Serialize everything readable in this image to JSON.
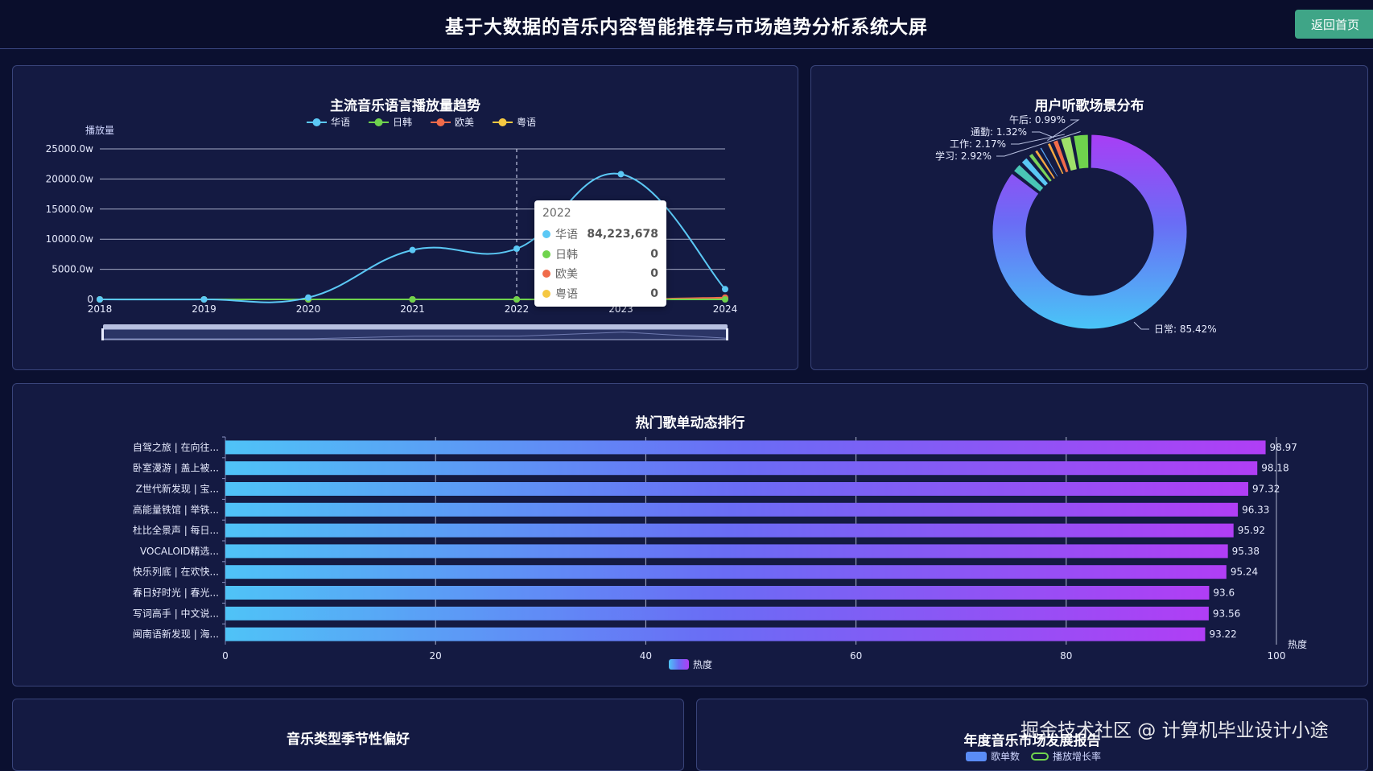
{
  "header": {
    "title": "基于大数据的音乐内容智能推荐与市场趋势分析系统大屏",
    "home_button": "返回首页"
  },
  "watermark": "掘金技术社区 @ 计算机毕业设计小途",
  "colors": {
    "cn": "#5bc8f5",
    "jk": "#6fd34d",
    "eu": "#f06b4a",
    "yue": "#f5c842",
    "bar_start": "#4fc3f7",
    "bar_end": "#b03ef5"
  },
  "tooltip": {
    "title": "2022",
    "rows": [
      {
        "name": "华语",
        "value": "84,223,678",
        "color": "#5bc8f5"
      },
      {
        "name": "日韩",
        "value": "0",
        "color": "#6fd34d"
      },
      {
        "name": "欧美",
        "value": "0",
        "color": "#f06b4a"
      },
      {
        "name": "粤语",
        "value": "0",
        "color": "#f5c842"
      }
    ]
  },
  "chart_data": [
    {
      "type": "line",
      "title": "主流音乐语言播放量趋势",
      "ylabel": "播放量",
      "x": [
        "2018",
        "2019",
        "2020",
        "2021",
        "2022",
        "2023",
        "2024"
      ],
      "ylim": [
        0,
        25000
      ],
      "yticks": [
        "0",
        "5000.0w",
        "10000.0w",
        "15000.0w",
        "20000.0w",
        "25000.0w"
      ],
      "legend": [
        "华语",
        "日韩",
        "欧美",
        "粤语"
      ],
      "series": [
        {
          "name": "华语",
          "values": [
            0,
            0,
            300,
            8200,
            8422,
            20800,
            1700
          ]
        },
        {
          "name": "日韩",
          "values": [
            0,
            0,
            0,
            0,
            0,
            0,
            0
          ]
        },
        {
          "name": "欧美",
          "values": [
            0,
            0,
            0,
            0,
            0,
            0,
            300
          ]
        },
        {
          "name": "粤语",
          "values": [
            0,
            0,
            0,
            0,
            0,
            0,
            100
          ]
        }
      ]
    },
    {
      "type": "pie",
      "title": "用户听歌场景分布",
      "labeled_slices": [
        {
          "label": "日常: 85.42%",
          "value": 85.42
        },
        {
          "label": "学习: 2.92%",
          "value": 2.92
        },
        {
          "label": "工作: 2.17%",
          "value": 2.17
        },
        {
          "label": "通勤: 1.32%",
          "value": 1.32
        },
        {
          "label": "午后: 0.99%",
          "value": 0.99
        }
      ],
      "other_slices": [
        1.9,
        1.6,
        1.2,
        1.0,
        0.8,
        0.6
      ]
    },
    {
      "type": "bar",
      "title": "热门歌单动态排行",
      "xlabel": "热度",
      "legend": "热度",
      "xlim": [
        0,
        100
      ],
      "xticks": [
        "0",
        "20",
        "40",
        "60",
        "80",
        "100"
      ],
      "categories": [
        "自驾之旅 | 在向往...",
        "卧室漫游 | 盖上被...",
        "Z世代新发现 | 宝...",
        "高能量铁馆 | 举铁...",
        "杜比全景声 | 每日...",
        "VOCALOID精选...",
        "快乐列底 | 在欢快...",
        "春日好时光 | 春光...",
        "写词高手 | 中文说...",
        "闽南语新发现 | 海..."
      ],
      "values": [
        98.97,
        98.18,
        97.32,
        96.33,
        95.92,
        95.38,
        95.24,
        93.6,
        93.56,
        93.22
      ],
      "value_labels": [
        "98.97",
        "98.18",
        "97.32",
        "96.33",
        "95.92",
        "95.38",
        "95.24",
        "93.6",
        "93.56",
        "93.22"
      ]
    }
  ],
  "bottom": {
    "season_title": "音乐类型季节性偏好",
    "annual_title": "年度音乐市场发展报告",
    "annual_legend": [
      "歌单数",
      "播放增长率"
    ]
  }
}
